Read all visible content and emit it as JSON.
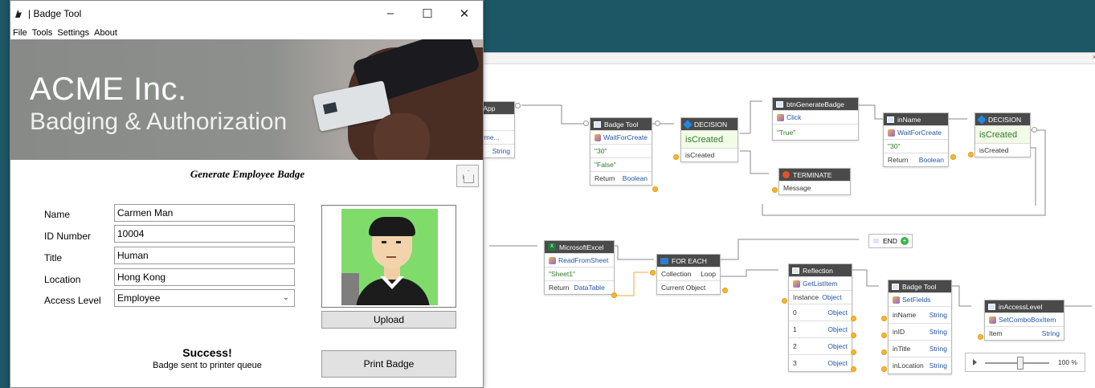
{
  "badge_tool": {
    "window_title": "| Badge Tool",
    "controls": {
      "minimize": "–",
      "maximize": "☐",
      "close": "✕"
    },
    "menu": [
      "File",
      "Tools",
      "Settings",
      "About"
    ],
    "banner": {
      "line1": "ACME Inc.",
      "line2": "Badging & Authorization"
    },
    "form_title": "Generate Employee Badge",
    "fields": {
      "name": {
        "label": "Name",
        "value": "Carmen Man"
      },
      "id": {
        "label": "ID Number",
        "value": "10004"
      },
      "title": {
        "label": "Title",
        "value": "Human"
      },
      "location": {
        "label": "Location",
        "value": "Hong Kong"
      },
      "access": {
        "label": "Access Level",
        "value": "Employee"
      }
    },
    "upload_label": "Upload",
    "print_label": "Print Badge",
    "status_title": "Success!",
    "status_sub": "Badge sent to printer queue"
  },
  "flow": {
    "close_glyph": "×",
    "partial_node": {
      "title": "ingApp",
      "row1": "carme...",
      "row2": "String"
    },
    "badge_tool_1": {
      "title": "Badge Tool",
      "action": "WaitForCreate",
      "arg1": "\"30\"",
      "arg2": "\"False\"",
      "ret_label": "Return",
      "ret_type": "Boolean"
    },
    "decision_1": {
      "title": "DECISION",
      "value": "isCreated",
      "input": "isCreated"
    },
    "btn_generate": {
      "title": "btnGenerateBadge",
      "action": "Click",
      "arg1": "\"True\""
    },
    "terminate": {
      "title": "TERMINATE",
      "input": "Message"
    },
    "in_name": {
      "title": "inName",
      "action": "WaitForCreate",
      "arg1": "\"30\"",
      "ret_label": "Return",
      "ret_type": "Boolean"
    },
    "decision_2": {
      "title": "DECISION",
      "value": "isCreated",
      "input": "isCreated"
    },
    "excel": {
      "title": "MicrosoftExcel",
      "action": "ReadFromSheet",
      "arg1": "\"Sheet1\"",
      "ret_label": "Return",
      "ret_type": "DataTable"
    },
    "foreach": {
      "title": "FOR EACH",
      "row1_label": "Collection",
      "row1_right": "Loop",
      "row2_label": "Current Object"
    },
    "end": {
      "title": "END"
    },
    "reflection": {
      "title": "Reflection",
      "action": "GetListItem",
      "row1_label": "Instance",
      "row1_type": "Object",
      "items": [
        {
          "idx": "0",
          "type": "Object"
        },
        {
          "idx": "1",
          "type": "Object"
        },
        {
          "idx": "2",
          "type": "Object"
        },
        {
          "idx": "3",
          "type": "Object"
        }
      ]
    },
    "badge_tool_2": {
      "title": "Badge Tool",
      "action": "SetFields",
      "fields": [
        {
          "name": "inName",
          "type": "String"
        },
        {
          "name": "inID",
          "type": "String"
        },
        {
          "name": "inTitle",
          "type": "String"
        },
        {
          "name": "inLocation",
          "type": "String"
        }
      ]
    },
    "access_level": {
      "title": "inAccessLevel",
      "action": "SetComboBoxItem",
      "row1_label": "Item",
      "row1_type": "String"
    },
    "zoom": {
      "percent": "100 %",
      "slider_level": 0.55
    }
  }
}
